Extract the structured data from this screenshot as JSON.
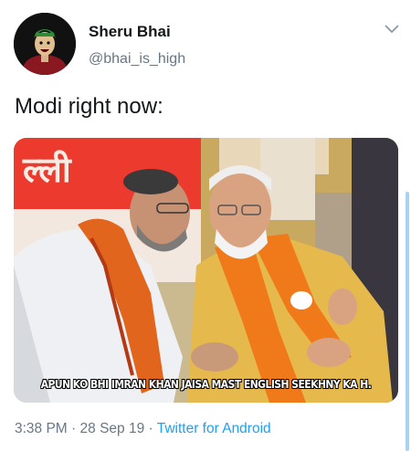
{
  "tweet": {
    "author_name": "Sheru Bhai",
    "author_handle": "@bhai_is_high",
    "text": "Modi right now:",
    "media": {
      "sign_text": "ल्ली",
      "caption": "APUN KO BHI IMRAN KHAN JAISA MAST ENGLISH SEEKHNY KA H."
    },
    "time": "3:38 PM",
    "separator": "·",
    "date": "28 Sep 19",
    "source": "Twitter for Android"
  },
  "colors": {
    "link": "#1da1f2",
    "secondary_text": "#657786",
    "saffron": "#f07a1a"
  },
  "icons": {
    "menu": "chevron-down-icon"
  }
}
